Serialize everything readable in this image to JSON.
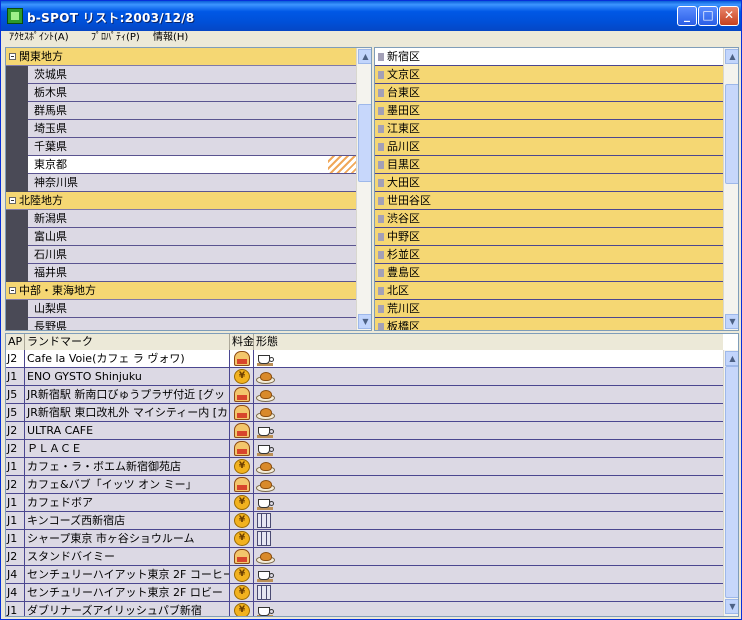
{
  "window": {
    "title": "b-SPOT リスト:2003/12/8"
  },
  "title_buttons": {
    "minimize": "_",
    "maximize": "□",
    "close": "✕"
  },
  "menu": [
    {
      "label": "ｱｸｾｽﾎﾟｲﾝﾄ(A)"
    },
    {
      "label": "ﾌﾟﾛﾊﾟﾃｨ(P)"
    },
    {
      "label": "情報(H)"
    }
  ],
  "tree": [
    {
      "type": "region",
      "label": "関東地方"
    },
    {
      "type": "pref",
      "label": "茨城県"
    },
    {
      "type": "pref",
      "label": "栃木県"
    },
    {
      "type": "pref",
      "label": "群馬県"
    },
    {
      "type": "pref",
      "label": "埼玉県"
    },
    {
      "type": "pref",
      "label": "千葉県"
    },
    {
      "type": "pref",
      "label": "東京都",
      "selected": true
    },
    {
      "type": "pref",
      "label": "神奈川県"
    },
    {
      "type": "region",
      "label": "北陸地方"
    },
    {
      "type": "pref",
      "label": "新潟県"
    },
    {
      "type": "pref",
      "label": "富山県"
    },
    {
      "type": "pref",
      "label": "石川県"
    },
    {
      "type": "pref",
      "label": "福井県"
    },
    {
      "type": "region",
      "label": "中部・東海地方"
    },
    {
      "type": "pref",
      "label": "山梨県"
    },
    {
      "type": "pref",
      "label": "長野県"
    }
  ],
  "wards": [
    {
      "label": "新宿区",
      "selected": true
    },
    {
      "label": "文京区"
    },
    {
      "label": "台東区"
    },
    {
      "label": "墨田区"
    },
    {
      "label": "江東区"
    },
    {
      "label": "品川区"
    },
    {
      "label": "目黒区"
    },
    {
      "label": "大田区"
    },
    {
      "label": "世田谷区"
    },
    {
      "label": "渋谷区"
    },
    {
      "label": "中野区"
    },
    {
      "label": "杉並区"
    },
    {
      "label": "豊島区"
    },
    {
      "label": "北区"
    },
    {
      "label": "荒川区"
    },
    {
      "label": "板橋区"
    }
  ],
  "list": {
    "columns": [
      "AP",
      "ランドマーク",
      "料金",
      "形態"
    ],
    "rows": [
      {
        "ap": "J2",
        "name": "Cafe la Voie(カフェ ラ ヴォワ)",
        "fee": "lock",
        "form": "cup",
        "selected": true
      },
      {
        "ap": "J1",
        "name": "ENO GYSTO Shinjuku",
        "fee": "coin",
        "form": "dish"
      },
      {
        "ap": "J5",
        "name": "JR新宿駅 新南口びゅうプラザ付近 [グッ",
        "fee": "lock",
        "form": "dish"
      },
      {
        "ap": "J5",
        "name": "JR新宿駅 東口改札外 マイシティー内 [カ",
        "fee": "lock",
        "form": "dish"
      },
      {
        "ap": "J2",
        "name": "ULTRA CAFE",
        "fee": "lock",
        "form": "cup"
      },
      {
        "ap": "J2",
        "name": "ＰＬＡＣＥ",
        "fee": "lock",
        "form": "cup"
      },
      {
        "ap": "J1",
        "name": "カフェ・ラ・ボエム新宿御苑店",
        "fee": "coin",
        "form": "dish"
      },
      {
        "ap": "J2",
        "name": "カフェ&バブ「イッツ オン ミー」",
        "fee": "lock",
        "form": "dish"
      },
      {
        "ap": "J1",
        "name": "カフェドボア",
        "fee": "coin",
        "form": "cup"
      },
      {
        "ap": "J1",
        "name": "キンコーズ西新宿店",
        "fee": "coin",
        "form": "building"
      },
      {
        "ap": "J1",
        "name": "シャープ東京 市ヶ谷ショウルーム",
        "fee": "coin",
        "form": "building"
      },
      {
        "ap": "J2",
        "name": "スタンドバイミー",
        "fee": "lock",
        "form": "dish"
      },
      {
        "ap": "J4",
        "name": "センチュリーハイアット東京 2F コーヒー",
        "fee": "coin",
        "form": "cup"
      },
      {
        "ap": "J4",
        "name": "センチュリーハイアット東京 2F ロビー",
        "fee": "coin",
        "form": "building"
      },
      {
        "ap": "J1",
        "name": "ダブリナーズアイリッシュパブ新宿",
        "fee": "coin",
        "form": "cup"
      }
    ]
  },
  "icons": {
    "coin_symbol": "¥"
  }
}
